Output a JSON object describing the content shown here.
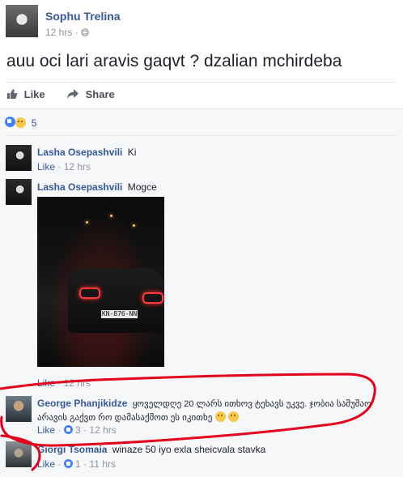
{
  "post": {
    "author": "Sophu Trelina",
    "time": "12 hrs",
    "privacy_icon": "globe-icon",
    "text": "auu oci lari aravis gaqvt ? dzalian mchirdeba"
  },
  "actions": {
    "like_label": "Like",
    "share_label": "Share"
  },
  "reactions": {
    "count": "5"
  },
  "comments": [
    {
      "author": "Lasha Osepashvili",
      "text": "Ki",
      "like_label": "Like",
      "time": "12 hrs"
    },
    {
      "author": "Lasha Osepashvili",
      "text": "Mogce",
      "plate_text": "KN-876-NN",
      "like_label": "Like",
      "time": "12 hrs"
    },
    {
      "author": "George Phanjikidze",
      "text": "ყოველდღე 20 ლარს ითხოვ ტეხავს უკვე. ჯობია სამუშაო არავის გაქვთ რო დამასაქმოთ ეს იკითხე",
      "like_label": "Like",
      "likes": "3",
      "time": "12 hrs"
    },
    {
      "author": "Giorgi Tsomaia",
      "text": "winaze 50 iyo exla sheicvala stavka",
      "like_label": "Like",
      "likes": "1",
      "time": "11 hrs"
    }
  ],
  "colors": {
    "name_link": "#365899",
    "meta": "#90949c",
    "annotation": "#e3001b",
    "comments_bg": "#f6f7f9"
  }
}
